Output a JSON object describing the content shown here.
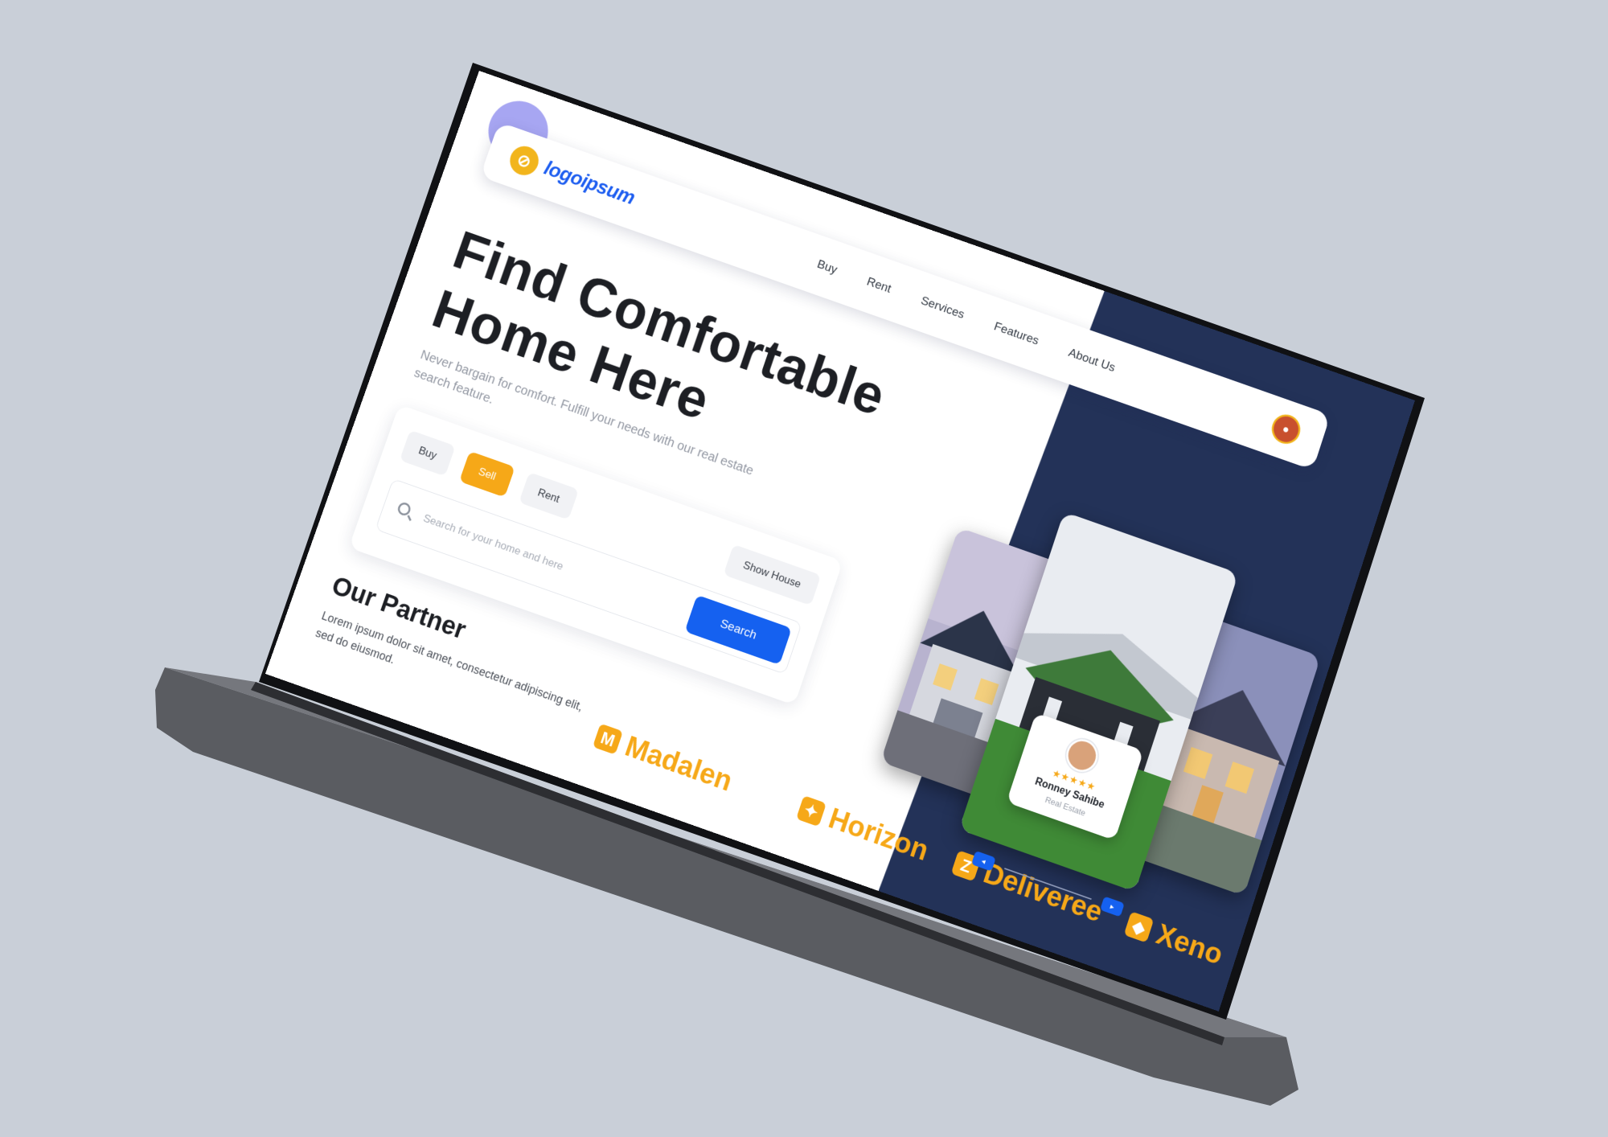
{
  "theme": {
    "background": "#c9cfd8",
    "dark_panel": "#233258",
    "accent": "#f6a818",
    "primary": "#1561f0",
    "logo_text_color": "#1e5ef0"
  },
  "brand": {
    "logo_text": "logoipsum",
    "logo_icon": "logo-mark-icon"
  },
  "nav": {
    "items": [
      "Buy",
      "Rent",
      "Services",
      "Features",
      "About Us"
    ]
  },
  "hero": {
    "title": "Find Comfortable\nHome Here",
    "subtitle": "Never bargain for comfort. Fulfill your needs with our real estate search feature."
  },
  "search": {
    "tabs": [
      {
        "label": "Buy",
        "active": false
      },
      {
        "label": "Sell",
        "active": true
      },
      {
        "label": "Rent",
        "active": false
      }
    ],
    "property_type": "Show House",
    "placeholder": "Search for your home and here",
    "button_label": "Search",
    "icon": "search-icon"
  },
  "partners": {
    "title": "Our Partner",
    "description": "Lorem ipsum dolor sit amet, consectetur adipiscing elit, sed do eiusmod.",
    "items": [
      {
        "name": "Madalen",
        "icon": "madalen-logo-icon",
        "color": "#f6a818"
      },
      {
        "name": "Horizon",
        "icon": "horizon-logo-icon",
        "color": "#f6a818"
      },
      {
        "name": "Deliveree",
        "icon": "deliveree-logo-icon",
        "color": "#f6a818"
      },
      {
        "name": "Xeno",
        "icon": "xeno-logo-icon",
        "color": "#f6a818"
      }
    ]
  },
  "gallery": {
    "agent": {
      "name": "Ronney Sahibe",
      "role": "Real Estate",
      "rating": 5
    },
    "nav": {
      "prev_icon": "chevron-left-icon",
      "next_icon": "chevron-right-icon"
    }
  }
}
